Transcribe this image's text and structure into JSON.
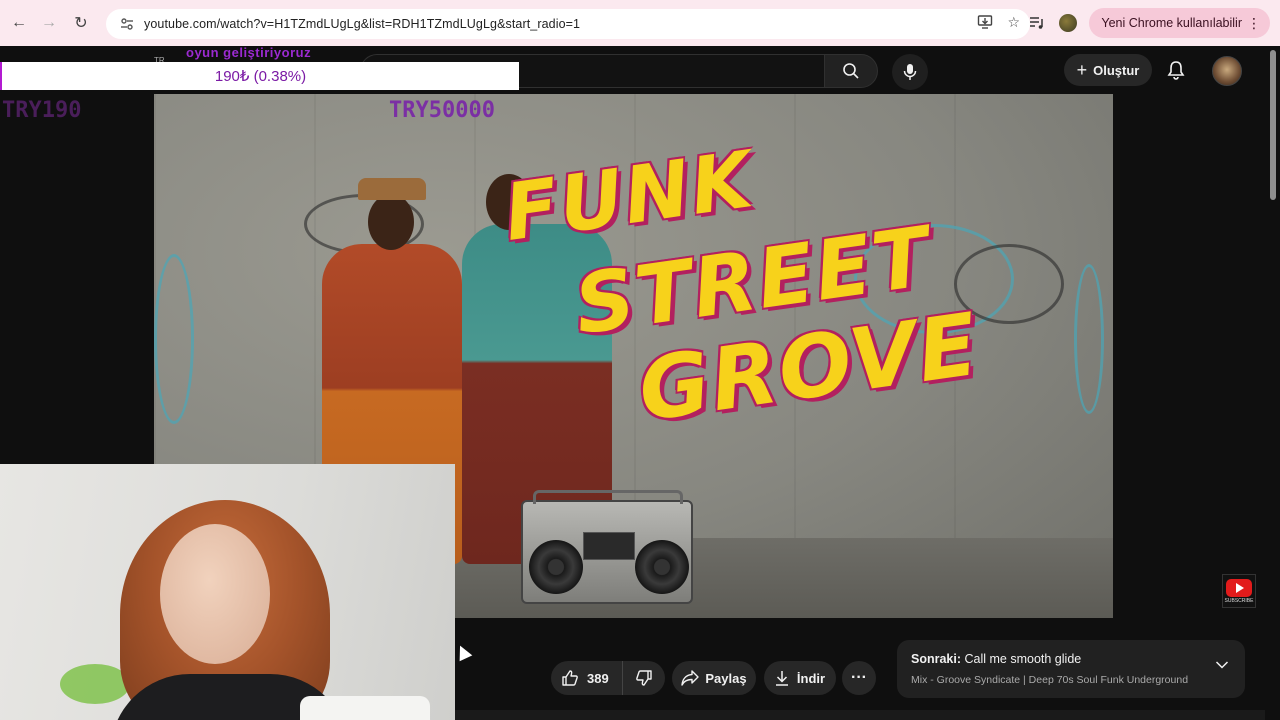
{
  "browser": {
    "url": "youtube.com/watch?v=H1TZmdLUgLg&list=RDH1TZmdLUgLg&start_radio=1",
    "chrome_pill_label": "Yeni Chrome kullanılabilir"
  },
  "youtube": {
    "create_label": "Oluştur"
  },
  "overlay": {
    "top_text": "oyun geliştiriyoruz",
    "tr_tag": "TR",
    "donation_progress": "190₺ (0.38%)",
    "progress_fraction": 0.0038,
    "current_amount": "TRY190",
    "goal_amount": "TRY50000"
  },
  "video": {
    "title_line1": "FUNK",
    "title_line2": "STREET",
    "title_line3": "GROVE",
    "subscribe_badge": "SUBSCRIBE"
  },
  "actions": {
    "like_count": "389",
    "share_label": "Paylaş",
    "download_label": "İndir"
  },
  "up_next": {
    "prefix": "Sonraki:",
    "title": "Call me smooth glide",
    "subtitle": "Mix - Groove Syndicate | Deep 70s Soul Funk Underground"
  },
  "colors": {
    "accent": "#f7d21b",
    "brand_red": "#e21b1b",
    "donation_purple": "#7b1aa5"
  }
}
